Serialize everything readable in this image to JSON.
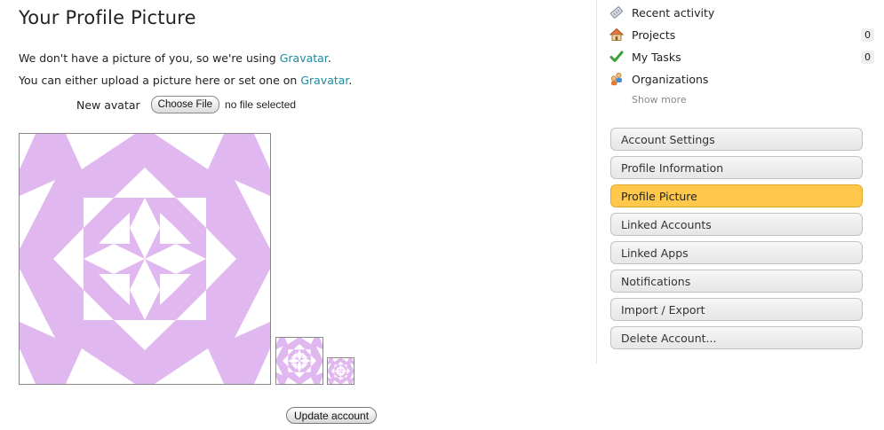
{
  "main": {
    "title": "Your Profile Picture",
    "line1": {
      "prefix": "We don't have a picture of you, so we're using ",
      "link": "Gravatar",
      "suffix": "."
    },
    "line2": {
      "prefix": "You can either upload a picture here or set one on ",
      "link": "Gravatar",
      "suffix": "."
    },
    "new_avatar_label": "New avatar",
    "choose_file_label": "Choose File",
    "no_file_text": "no file selected",
    "update_button_label": "Update account",
    "avatar_color": "#e0b8ef"
  },
  "sidebar": {
    "nav": [
      {
        "label": "Recent activity",
        "icon": "clipboard-icon"
      },
      {
        "label": "Projects",
        "icon": "house-icon",
        "count": "0"
      },
      {
        "label": "My Tasks",
        "icon": "checkmark-icon",
        "count": "0"
      },
      {
        "label": "Organizations",
        "icon": "people-icon"
      }
    ],
    "show_more": "Show more",
    "menu": [
      {
        "label": "Account Settings"
      },
      {
        "label": "Profile Information"
      },
      {
        "label": "Profile Picture",
        "active": true
      },
      {
        "label": "Linked Accounts"
      },
      {
        "label": "Linked Apps"
      },
      {
        "label": "Notifications"
      },
      {
        "label": "Import / Export"
      },
      {
        "label": "Delete Account..."
      }
    ],
    "active_color": "#ffc84a"
  }
}
